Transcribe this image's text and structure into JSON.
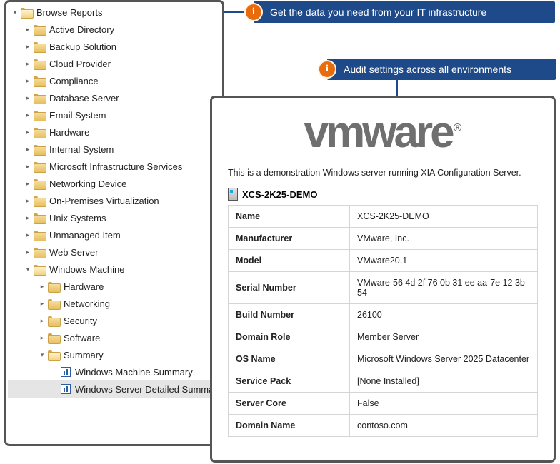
{
  "callouts": {
    "c1": "Get the data you need from your IT infrastructure",
    "c2": "Audit settings across all environments"
  },
  "tree": {
    "root_label": "Browse Reports",
    "items": [
      "Active Directory",
      "Backup Solution",
      "Cloud Provider",
      "Compliance",
      "Database Server",
      "Email System",
      "Hardware",
      "Internal System",
      "Microsoft Infrastructure Services",
      "Networking Device",
      "On-Premises Virtualization",
      "Unix Systems",
      "Unmanaged Item",
      "Web Server"
    ],
    "wm_label": "Windows Machine",
    "wm_children": [
      "Hardware",
      "Networking",
      "Security",
      "Software"
    ],
    "summary_label": "Summary",
    "summary_children": [
      "Windows Machine Summary",
      "Windows Server Detailed Summary"
    ]
  },
  "card": {
    "logo_text": "vmware",
    "logo_reg": "®",
    "description": "This is a demonstration Windows server running XIA Configuration Server.",
    "host": "XCS-2K25-DEMO",
    "rows": [
      {
        "k": "Name",
        "v": "XCS-2K25-DEMO"
      },
      {
        "k": "Manufacturer",
        "v": "VMware, Inc."
      },
      {
        "k": "Model",
        "v": "VMware20,1"
      },
      {
        "k": "Serial Number",
        "v": "VMware-56 4d 2f 76 0b 31 ee aa-7e 12 3b 54"
      },
      {
        "k": "Build Number",
        "v": "26100"
      },
      {
        "k": "Domain Role",
        "v": "Member Server"
      },
      {
        "k": "OS Name",
        "v": "Microsoft Windows Server 2025 Datacenter"
      },
      {
        "k": "Service Pack",
        "v": "[None Installed]"
      },
      {
        "k": "Server Core",
        "v": "False"
      },
      {
        "k": "Domain Name",
        "v": "contoso.com"
      }
    ]
  }
}
